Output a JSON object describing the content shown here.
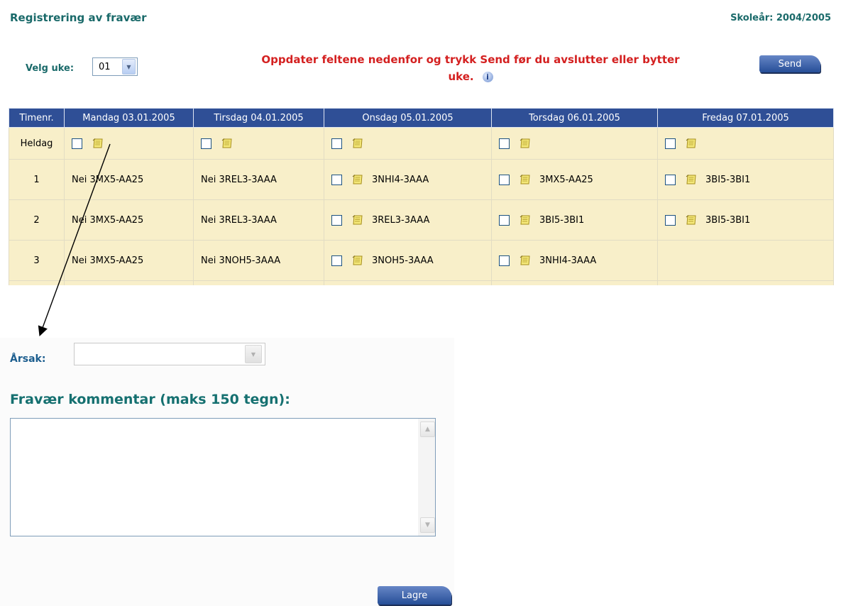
{
  "header": {
    "title": "Registrering av fravær",
    "school_year": "Skoleår: 2004/2005"
  },
  "week": {
    "label": "Velg uke:",
    "selected": "01"
  },
  "warning": {
    "line1": "Oppdater feltene nedenfor og trykk Send før du avslutter eller bytter",
    "line2": "uke."
  },
  "send_label": "Send",
  "table": {
    "columns": [
      "Timenr.",
      "Mandag 03.01.2005",
      "Tirsdag 04.01.2005",
      "Onsdag 05.01.2005",
      "Torsdag 06.01.2005",
      "Fredag 07.01.2005"
    ],
    "heldag_label": "Heldag",
    "rows": [
      {
        "num": "1",
        "mon": "Nei 3MX5-AA25",
        "tue": "Nei 3REL3-3AAA",
        "wed": "3NHI4-3AAA",
        "thu": "3MX5-AA25",
        "fri": "3BI5-3BI1"
      },
      {
        "num": "2",
        "mon": "Nei 3MX5-AA25",
        "tue": "Nei 3REL3-3AAA",
        "wed": "3REL3-3AAA",
        "thu": "3BI5-3BI1",
        "fri": "3BI5-3BI1"
      },
      {
        "num": "3",
        "mon": "Nei 3MX5-AA25",
        "tue": "Nei 3NOH5-3AAA",
        "wed": "3NOH5-3AAA",
        "thu": "3NHI4-3AAA",
        "fri": ""
      }
    ]
  },
  "arsak": {
    "label": "Årsak:",
    "value": ""
  },
  "comment": {
    "label": "Fravær kommentar (maks 150 tegn):",
    "value": ""
  },
  "save_label": "Lagre",
  "colors": {
    "header_bg": "#2f4f96",
    "cell_bg": "#f8efc9",
    "title": "#1a6a6a",
    "warning": "#d42020"
  }
}
